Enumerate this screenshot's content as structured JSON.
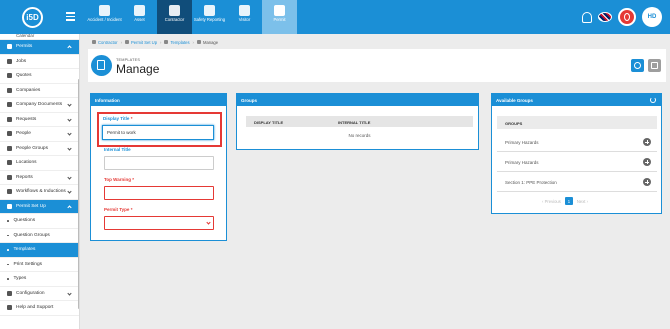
{
  "logo": "i5D",
  "nav": [
    {
      "label": "Accident / Incident",
      "icon": "first-aid-icon"
    },
    {
      "label": "Asset",
      "icon": "asset-icon"
    },
    {
      "label": "Contractor",
      "icon": "contractor-icon"
    },
    {
      "label": "Safety Reporting",
      "icon": "safety-reporting-icon"
    },
    {
      "label": "Visitor",
      "icon": "visitor-icon"
    },
    {
      "label": "Permit",
      "icon": "permit-icon"
    }
  ],
  "user": {
    "initials": "HD"
  },
  "sidebar": {
    "partial_top": "Calendar",
    "items": [
      {
        "label": "Permits",
        "active": true,
        "chevron": true
      },
      {
        "label": "Jobs"
      },
      {
        "label": "Quotes"
      },
      {
        "label": "Companies"
      },
      {
        "label": "Company Documents",
        "chevron": true
      },
      {
        "label": "Requests",
        "chevron": true
      },
      {
        "label": "People",
        "chevron": true
      },
      {
        "label": "People Groups",
        "chevron": true
      },
      {
        "label": "Locations"
      },
      {
        "label": "Reports",
        "chevron": true
      },
      {
        "label": "Workflows & Inductions",
        "chevron": true
      },
      {
        "label": "Permit Set Up",
        "active": true,
        "chevron": true
      },
      {
        "label": "Questions",
        "sub": true
      },
      {
        "label": "Question Groups",
        "sub": true
      },
      {
        "label": "Templates",
        "sub": true,
        "active": true
      },
      {
        "label": "Print Settings",
        "sub": true
      },
      {
        "label": "Types",
        "sub": true
      },
      {
        "label": "Configuration",
        "chevron": true
      },
      {
        "label": "Help and Support"
      }
    ]
  },
  "breadcrumb": [
    "Contractor",
    "Permit Set Up",
    "Templates",
    "Manage"
  ],
  "header": {
    "subtitle": "TEMPLATES",
    "title": "Manage"
  },
  "info": {
    "title": "Information",
    "display_title_label": "Display Title",
    "display_title_value": "Permit to work",
    "internal_title_label": "Internal Title",
    "top_warning_label": "Top Warning",
    "permit_type_label": "Permit Type",
    "required_mark": "*"
  },
  "groups": {
    "title": "Groups",
    "columns": [
      "DISPLAY TITLE",
      "INTERNAL TITLE"
    ],
    "empty_text": "No records"
  },
  "available_groups": {
    "title": "Available Groups",
    "column": "GROUPS",
    "rows": [
      "Primary Hazards",
      "Primary Hazards",
      "Section 1: PPE Protection"
    ],
    "pager": {
      "previous": "Previous",
      "current": "1",
      "next": "Next"
    }
  }
}
